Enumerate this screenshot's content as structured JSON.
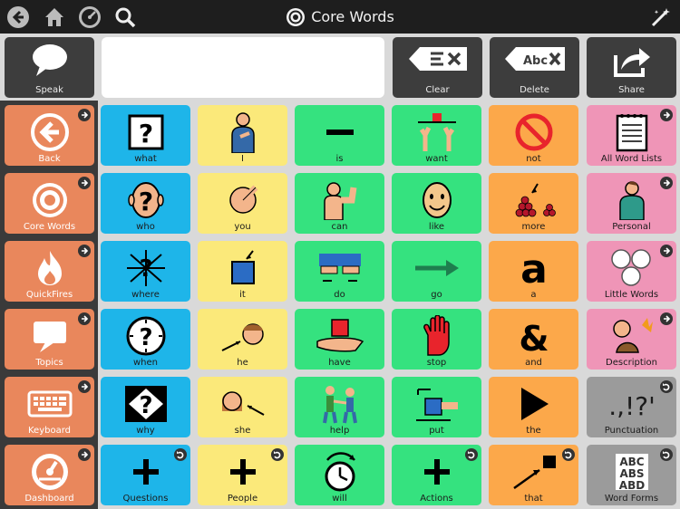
{
  "title": "Core Words",
  "toolbar": {
    "speak_label": "Speak",
    "clear_label": "Clear",
    "delete_label": "Delete",
    "share_label": "Share",
    "message_text": ""
  },
  "colors": {
    "blue": "#1eb5e9",
    "yellow": "#fbe97a",
    "green": "#35e27f",
    "orange": "#fca84a",
    "pink": "#ef95b7",
    "gray": "#9b9b9b",
    "sidebar": "#e9875c"
  },
  "sidebar": [
    {
      "label": "Back",
      "icon": "back-arrow-icon"
    },
    {
      "label": "Core Words",
      "icon": "target-icon"
    },
    {
      "label": "QuickFires",
      "icon": "flame-icon"
    },
    {
      "label": "Topics",
      "icon": "speech-bubble-icon"
    },
    {
      "label": "Keyboard",
      "icon": "keyboard-icon"
    },
    {
      "label": "Dashboard",
      "icon": "dashboard-icon"
    }
  ],
  "grid": [
    [
      {
        "label": "what",
        "color": "blue",
        "icon": "question-mark-icon"
      },
      {
        "label": "I",
        "color": "yellow",
        "icon": "person-pointing-self-icon"
      },
      {
        "label": "is",
        "color": "green",
        "icon": "dash-icon"
      },
      {
        "label": "want",
        "color": "green",
        "icon": "hands-reaching-icon"
      },
      {
        "label": "not",
        "color": "orange",
        "icon": "no-symbol-icon"
      },
      {
        "label": "All Word Lists",
        "color": "pink",
        "icon": "notebook-icon"
      }
    ],
    [
      {
        "label": "who",
        "color": "blue",
        "icon": "question-head-icon"
      },
      {
        "label": "you",
        "color": "yellow",
        "icon": "pointing-hand-icon"
      },
      {
        "label": "can",
        "color": "green",
        "icon": "flexing-arm-icon"
      },
      {
        "label": "like",
        "color": "green",
        "icon": "smiling-face-icon"
      },
      {
        "label": "more",
        "color": "orange",
        "icon": "pile-of-berries-icon"
      },
      {
        "label": "Personal",
        "color": "pink",
        "icon": "person-icon"
      }
    ],
    [
      {
        "label": "where",
        "color": "blue",
        "icon": "question-arrows-icon"
      },
      {
        "label": "it",
        "color": "yellow",
        "icon": "blue-square-icon"
      },
      {
        "label": "do",
        "color": "green",
        "icon": "hands-doing-icon"
      },
      {
        "label": "go",
        "color": "green",
        "icon": "right-arrow-icon"
      },
      {
        "label": "a",
        "color": "orange",
        "icon": "letter-a-icon"
      },
      {
        "label": "Little Words",
        "color": "pink",
        "icon": "circles-icon"
      }
    ],
    [
      {
        "label": "when",
        "color": "blue",
        "icon": "question-clock-icon"
      },
      {
        "label": "he",
        "color": "yellow",
        "icon": "boy-face-icon"
      },
      {
        "label": "have",
        "color": "green",
        "icon": "hand-holding-box-icon"
      },
      {
        "label": "stop",
        "color": "green",
        "icon": "red-hand-icon"
      },
      {
        "label": "and",
        "color": "orange",
        "icon": "ampersand-icon"
      },
      {
        "label": "Description",
        "color": "pink",
        "icon": "description-icon"
      }
    ],
    [
      {
        "label": "why",
        "color": "blue",
        "icon": "question-diamond-icon"
      },
      {
        "label": "she",
        "color": "yellow",
        "icon": "girl-face-icon"
      },
      {
        "label": "help",
        "color": "green",
        "icon": "people-helping-icon"
      },
      {
        "label": "put",
        "color": "green",
        "icon": "hand-putting-icon"
      },
      {
        "label": "the",
        "color": "orange",
        "icon": "play-triangle-icon"
      },
      {
        "label": "Punctuation",
        "color": "gray",
        "icon": "punctuation-icon"
      }
    ],
    [
      {
        "label": "Questions",
        "color": "blue",
        "icon": "plus-icon"
      },
      {
        "label": "People",
        "color": "yellow",
        "icon": "plus-icon"
      },
      {
        "label": "will",
        "color": "green",
        "icon": "timer-clock-icon"
      },
      {
        "label": "Actions",
        "color": "green",
        "icon": "plus-icon"
      },
      {
        "label": "that",
        "color": "orange",
        "icon": "arrow-to-square-icon"
      },
      {
        "label": "Word Forms",
        "color": "gray",
        "icon": "abc-blocks-icon"
      }
    ]
  ]
}
